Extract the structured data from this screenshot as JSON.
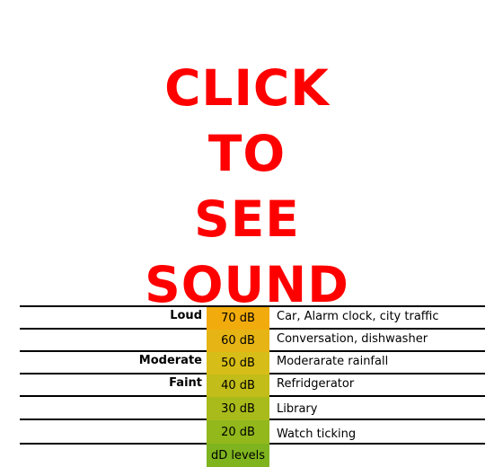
{
  "cta": {
    "lines": [
      "CLICK",
      "TO",
      "SEE",
      "SOUND"
    ]
  },
  "colors": {
    "cta": "#ff0000"
  },
  "levels": [
    {
      "db": "70 dB",
      "description": "Car, Alarm clock, city traffic",
      "intensity": "Loud",
      "color": "#f2ab0c"
    },
    {
      "db": "60 dB",
      "description": "Conversation, dishwasher",
      "intensity": "",
      "color": "#e6b515"
    },
    {
      "db": "50 dB",
      "description": "Moderarate rainfall",
      "intensity": "Moderate",
      "color": "#d7bd17"
    },
    {
      "db": "40 dB",
      "description": "Refridgerator",
      "intensity": "Faint",
      "color": "#c2bd18"
    },
    {
      "db": "30 dB",
      "description": "Library",
      "intensity": "",
      "color": "#a9bb1a"
    },
    {
      "db": "20 dB",
      "description": "Watch ticking",
      "intensity": "",
      "color": "#92b81c"
    }
  ],
  "footer_label": {
    "text": "dD levels",
    "color": "#7fb41f"
  }
}
